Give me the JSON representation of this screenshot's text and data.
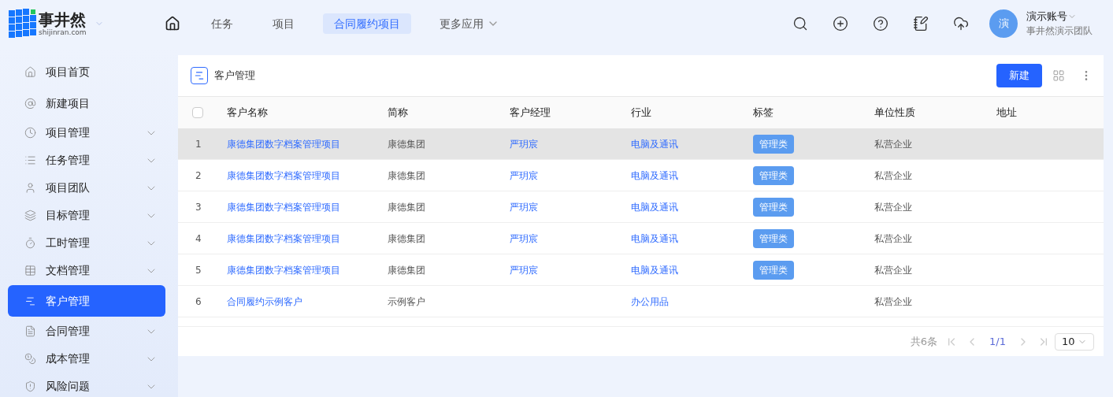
{
  "logo": {
    "name": "事井然",
    "domain": "shijinran.com"
  },
  "top_nav": [
    {
      "kind": "home",
      "selected": false
    },
    {
      "label": "任务",
      "selected": false,
      "dropdown": false
    },
    {
      "label": "项目",
      "selected": false,
      "dropdown": false
    },
    {
      "label": "合同履约项目",
      "selected": true,
      "dropdown": false
    },
    {
      "label": "更多应用",
      "selected": false,
      "dropdown": true
    }
  ],
  "account": {
    "avatar": "演",
    "name": "演示账号",
    "team": "事井然演示团队"
  },
  "sidebar": {
    "items": [
      {
        "label": "项目首页",
        "expandable": false,
        "selected": false
      },
      {
        "label": "新建项目",
        "expandable": false,
        "selected": false
      },
      {
        "label": "项目管理",
        "expandable": true,
        "selected": false
      },
      {
        "label": "任务管理",
        "expandable": true,
        "selected": false
      },
      {
        "label": "项目团队",
        "expandable": true,
        "selected": false
      },
      {
        "label": "目标管理",
        "expandable": true,
        "selected": false
      },
      {
        "label": "工时管理",
        "expandable": true,
        "selected": false
      },
      {
        "label": "文档管理",
        "expandable": true,
        "selected": false
      },
      {
        "label": "客户管理",
        "expandable": false,
        "selected": true
      },
      {
        "label": "合同管理",
        "expandable": true,
        "selected": false
      },
      {
        "label": "成本管理",
        "expandable": true,
        "selected": false
      },
      {
        "label": "风险问题",
        "expandable": true,
        "selected": false
      }
    ]
  },
  "panel": {
    "title": "客户管理",
    "new_button": "新建"
  },
  "table": {
    "columns": [
      "客户名称",
      "简称",
      "客户经理",
      "行业",
      "标签",
      "单位性质",
      "地址"
    ],
    "all_checked": false,
    "rows": [
      {
        "index": "1",
        "name": "康德集团数字档案管理项目",
        "short": "康德集团",
        "manager": "严玥宸",
        "industry": "电脑及通讯",
        "tag": "管理类",
        "nature": "私营企业",
        "highlighted": true
      },
      {
        "index": "2",
        "name": "康德集团数字档案管理项目",
        "short": "康德集团",
        "manager": "严玥宸",
        "industry": "电脑及通讯",
        "tag": "管理类",
        "nature": "私营企业",
        "highlighted": false
      },
      {
        "index": "3",
        "name": "康德集团数字档案管理项目",
        "short": "康德集团",
        "manager": "严玥宸",
        "industry": "电脑及通讯",
        "tag": "管理类",
        "nature": "私营企业",
        "highlighted": false
      },
      {
        "index": "4",
        "name": "康德集团数字档案管理项目",
        "short": "康德集团",
        "manager": "严玥宸",
        "industry": "电脑及通讯",
        "tag": "管理类",
        "nature": "私营企业",
        "highlighted": false
      },
      {
        "index": "5",
        "name": "康德集团数字档案管理项目",
        "short": "康德集团",
        "manager": "严玥宸",
        "industry": "电脑及通讯",
        "tag": "管理类",
        "nature": "私营企业",
        "highlighted": false
      },
      {
        "index": "6",
        "name": "合同履约示例客户",
        "short": "示例客户",
        "industry": "办公用品",
        "nature": "私营企业",
        "highlighted": false
      }
    ]
  },
  "pagination": {
    "total": "共6条",
    "page": "1/1",
    "page_size": "10"
  }
}
